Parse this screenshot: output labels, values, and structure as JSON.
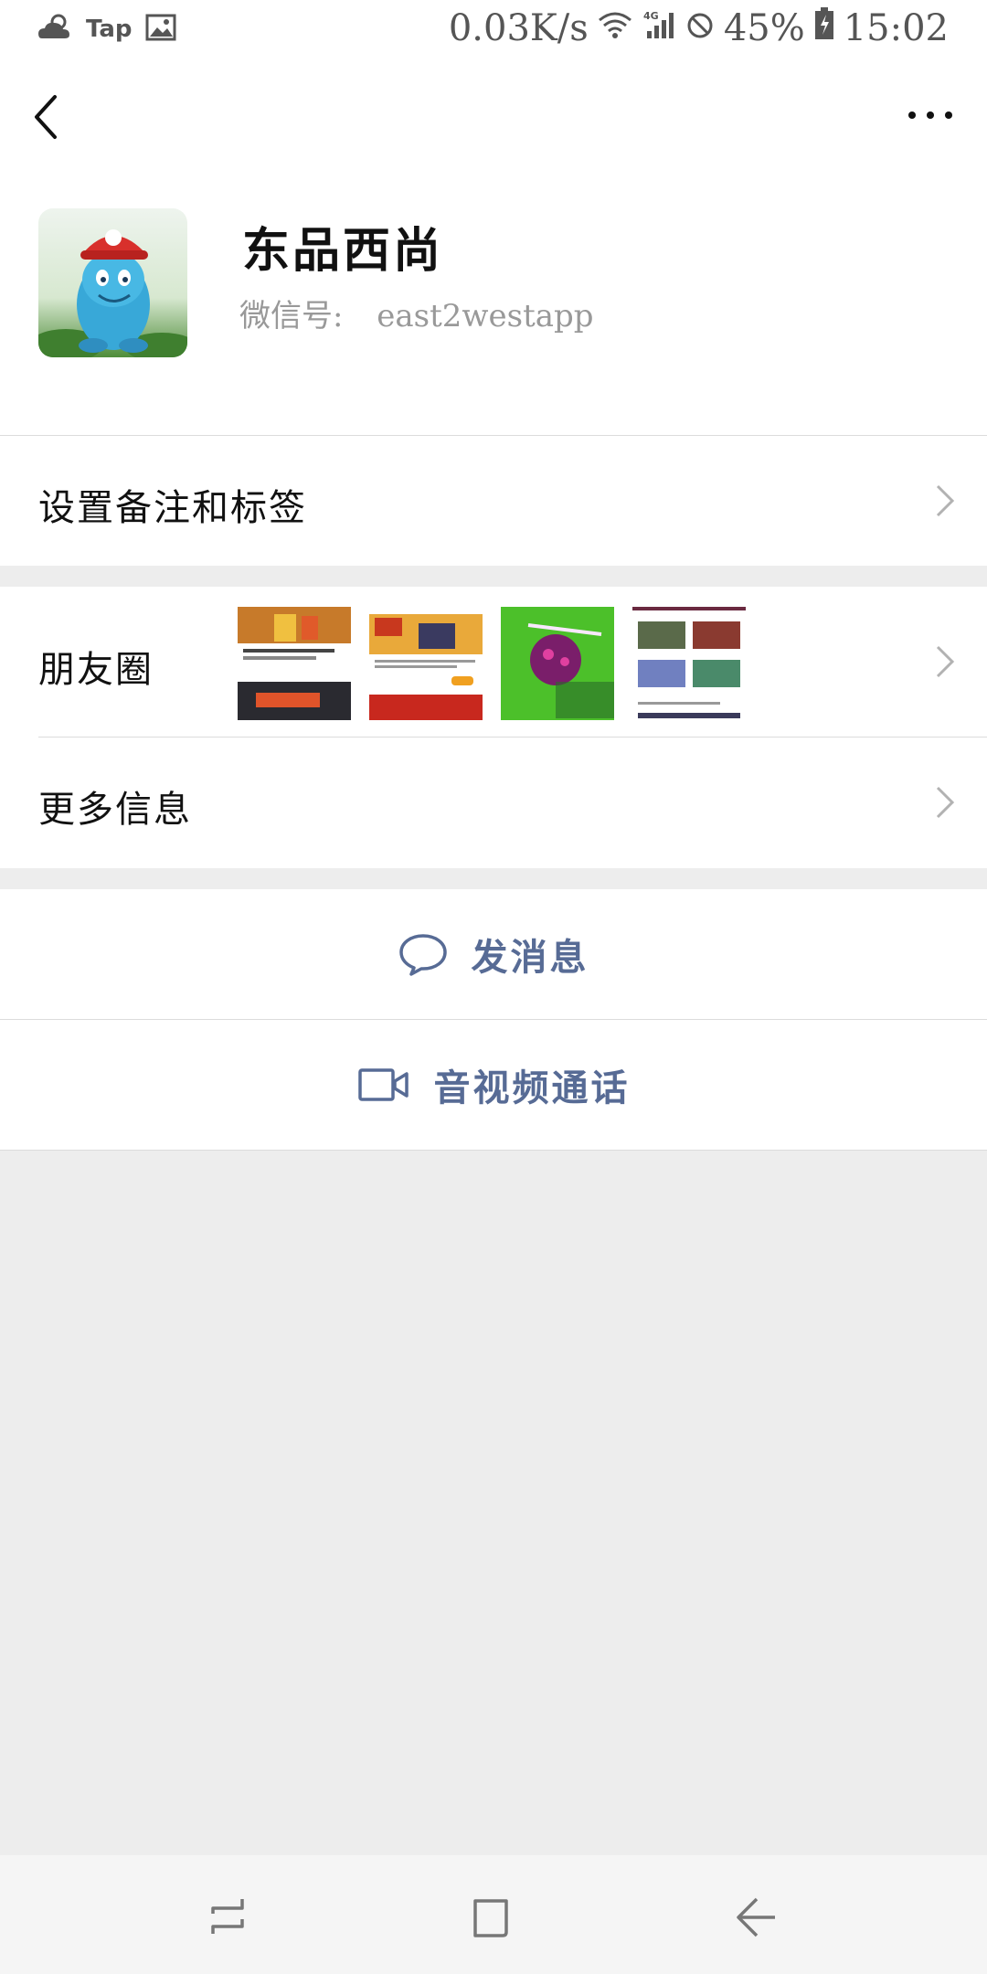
{
  "status_bar": {
    "tap_label": "Tap",
    "network_speed": "0.03K/s",
    "network_type": "4G",
    "battery": "45%",
    "time": "15:02"
  },
  "nav": {
    "back_icon": "back-arrow-icon",
    "more_icon": "more-dots-icon"
  },
  "profile": {
    "name": "东品西尚",
    "wechat_id_label": "微信号:",
    "wechat_id": "east2westapp"
  },
  "menu": {
    "remarks_tags": "设置备注和标签",
    "moments": "朋友圈",
    "more_info": "更多信息"
  },
  "actions": {
    "send_message": "发消息",
    "video_call": "音视频通话"
  },
  "colors": {
    "accent_link": "#576b95",
    "background": "#ededed",
    "card": "#ffffff"
  }
}
